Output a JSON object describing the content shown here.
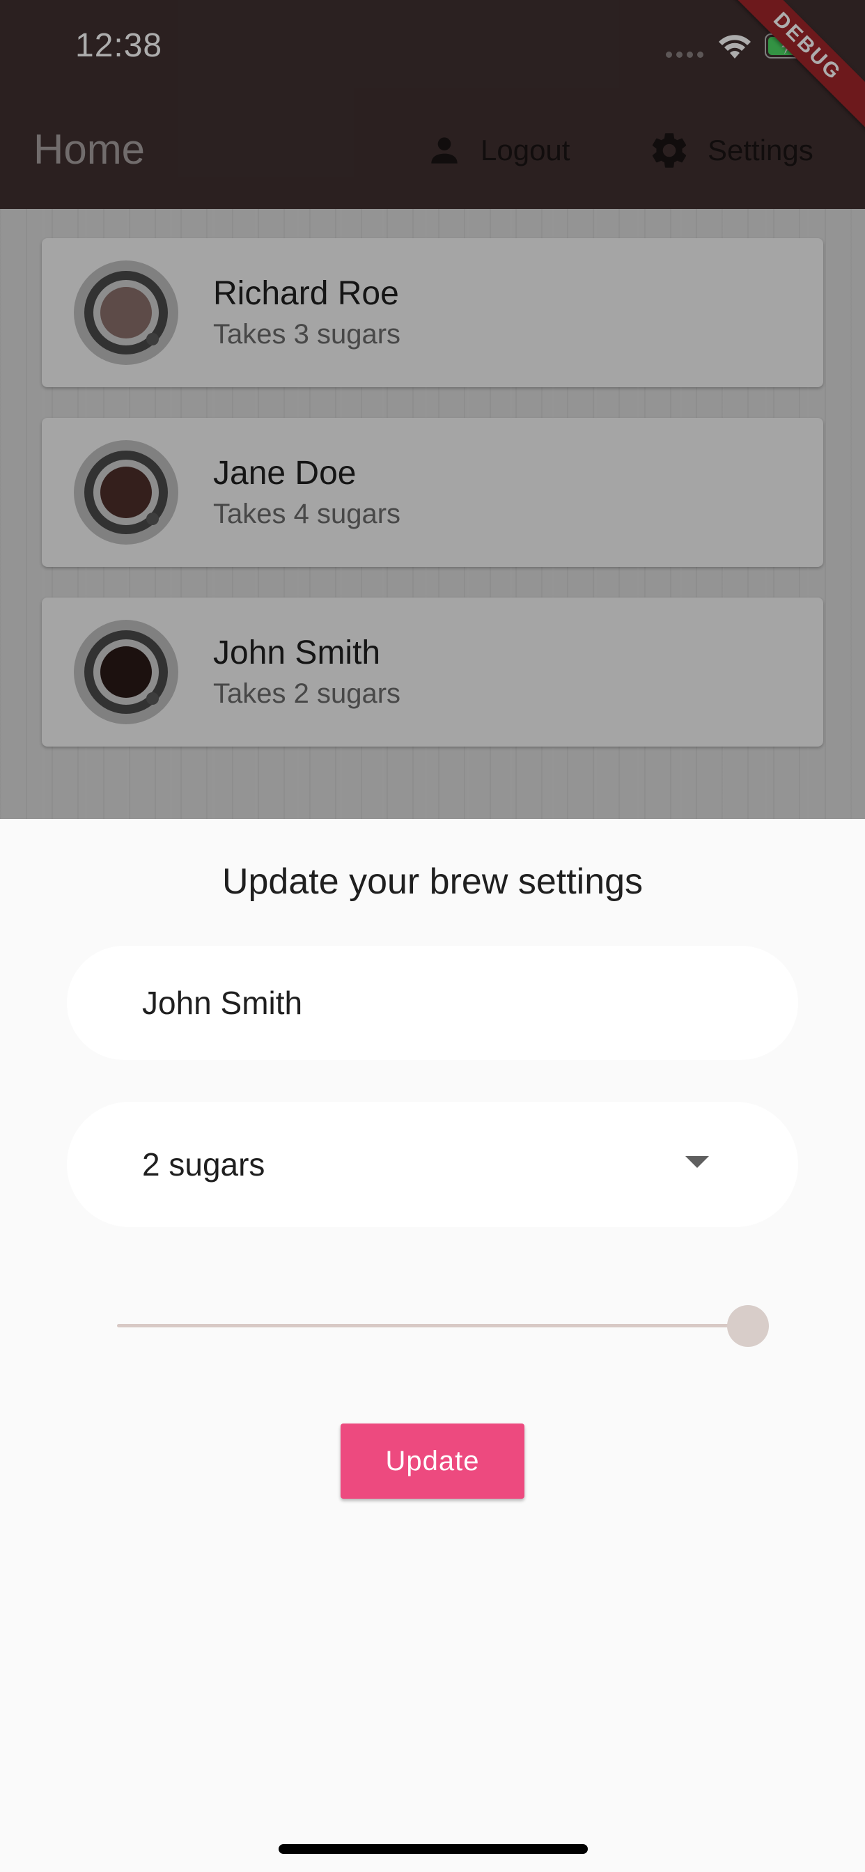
{
  "status_bar": {
    "time": "12:38"
  },
  "app_bar": {
    "title": "Home",
    "logout_label": "Logout",
    "settings_label": "Settings",
    "debug_label": "DEBUG",
    "background_color": "#403030"
  },
  "brew_list": [
    {
      "name": "Richard Roe",
      "subtitle": "Takes 3 sugars",
      "coffee_color": "#8a6f6a"
    },
    {
      "name": "Jane Doe",
      "subtitle": "Takes 4 sugars",
      "coffee_color": "#4d2f2a"
    },
    {
      "name": "John Smith",
      "subtitle": "Takes 2 sugars",
      "coffee_color": "#2a1a17"
    }
  ],
  "settings_sheet": {
    "title": "Update your brew settings",
    "name_value": "John Smith",
    "sugars_selected": "2 sugars",
    "strength_slider": {
      "value": 1.0
    },
    "update_label": "Update",
    "accent_color": "#ed4a7f"
  },
  "icons": {
    "logout": "person-icon",
    "settings": "gear-icon",
    "dropdown": "arrow-drop-down-icon",
    "coffee": "coffee-cup-icon"
  }
}
